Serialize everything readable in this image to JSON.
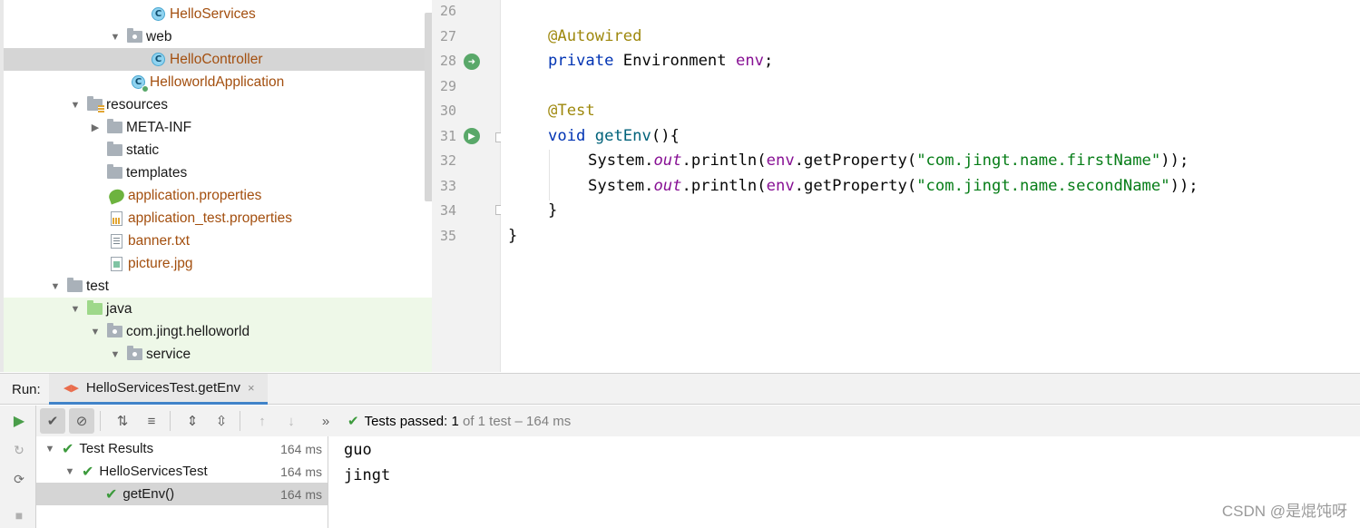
{
  "project_tree": {
    "items": [
      {
        "label": "HelloServices",
        "icon": "class-icon",
        "modified": true
      },
      {
        "label": "web",
        "icon": "package-icon",
        "expanded": true
      },
      {
        "label": "HelloController",
        "icon": "class-icon",
        "modified": true,
        "selected": true
      },
      {
        "label": "HelloworldApplication",
        "icon": "spring-app-icon",
        "modified": true
      },
      {
        "label": "resources",
        "icon": "resources-folder-icon",
        "expanded": true
      },
      {
        "label": "META-INF",
        "icon": "folder-icon",
        "expanded": false
      },
      {
        "label": "static",
        "icon": "folder-icon"
      },
      {
        "label": "templates",
        "icon": "folder-icon"
      },
      {
        "label": "application.properties",
        "icon": "spring-properties-icon",
        "modified": true
      },
      {
        "label": "application_test.properties",
        "icon": "properties-file-icon",
        "modified": true
      },
      {
        "label": "banner.txt",
        "icon": "text-file-icon",
        "modified": true
      },
      {
        "label": "picture.jpg",
        "icon": "image-file-icon",
        "modified": true
      },
      {
        "label": "test",
        "icon": "folder-icon",
        "expanded": true
      },
      {
        "label": "java",
        "icon": "test-source-folder-icon",
        "expanded": true
      },
      {
        "label": "com.jingt.helloworld",
        "icon": "package-icon",
        "expanded": true
      },
      {
        "label": "service",
        "icon": "package-icon",
        "expanded": true
      }
    ]
  },
  "editor": {
    "line_numbers": [
      "26",
      "27",
      "28",
      "29",
      "30",
      "31",
      "32",
      "33",
      "34",
      "35"
    ],
    "annotation_autowired": "@Autowired",
    "kw_private": "private",
    "type_environment": " Environment ",
    "field_env": "env",
    "semi": ";",
    "annotation_test": "@Test",
    "kw_void": "void",
    "method_getenv": " getEnv",
    "method_tail": "(){",
    "sys1": "System.",
    "out1": "out",
    "println1": ".println(",
    "env1": "env",
    "getprop1": ".getProperty(",
    "str1": "\"com.jingt.name.firstName\"",
    "end1": "));",
    "sys2": "System.",
    "out2": "out",
    "println2": ".println(",
    "env2": "env",
    "getprop2": ".getProperty(",
    "str2": "\"com.jingt.name.secondName\"",
    "end2": "));",
    "close_method": "}",
    "close_class": "}"
  },
  "run_panel": {
    "label": "Run:",
    "tab_title": "HelloServicesTest.getEnv",
    "tab_close": "×",
    "status_prefix": "Tests passed:",
    "status_passed": "1",
    "status_rest": "of 1 test – 164 ms",
    "results": [
      {
        "name": "Test Results",
        "time": "164 ms"
      },
      {
        "name": "HelloServicesTest",
        "time": "164 ms"
      },
      {
        "name": "getEnv()",
        "time": "164 ms"
      }
    ],
    "console_lines": [
      "guo",
      "jingt"
    ]
  },
  "watermark": "CSDN @是焜饨呀",
  "colors": {
    "selection": "#d5d5d5",
    "test_source_bg": "#eef8e8",
    "modified_file": "#a34f0f",
    "keyword": "#0033b3",
    "annotation": "#9e880d",
    "string": "#067d17",
    "field": "#871094",
    "pass_green": "#3c9a3c"
  }
}
